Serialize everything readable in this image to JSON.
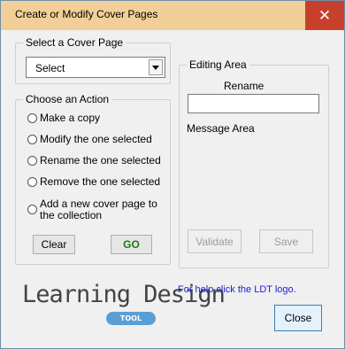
{
  "window": {
    "title": "Create or Modify Cover Pages",
    "close_glyph": "✕"
  },
  "select_group": {
    "legend": "Select a Cover Page",
    "selected_value": "Select"
  },
  "action_group": {
    "legend": "Choose an Action",
    "options": [
      "Make a copy",
      "Modify the one selected",
      "Rename the one selected",
      "Remove the one selected",
      "Add a new cover page to",
      "the collection"
    ],
    "clear_label": "Clear",
    "go_label": "GO"
  },
  "editing_group": {
    "legend": "Editing Area",
    "rename_label": "Rename",
    "rename_value": "",
    "message_label": "Message Area",
    "validate_label": "Validate",
    "save_label": "Save"
  },
  "footer": {
    "logo_text": "Learning Design",
    "logo_badge": "TOOL",
    "help_text": "For help click the LDT logo.",
    "close_label": "Close"
  },
  "colors": {
    "titlebar": "#f2cf98",
    "close_button": "#c7402c",
    "go_text": "#1a7a1a",
    "help_link": "#1a1adb",
    "logo_badge": "#5a9fd4"
  }
}
